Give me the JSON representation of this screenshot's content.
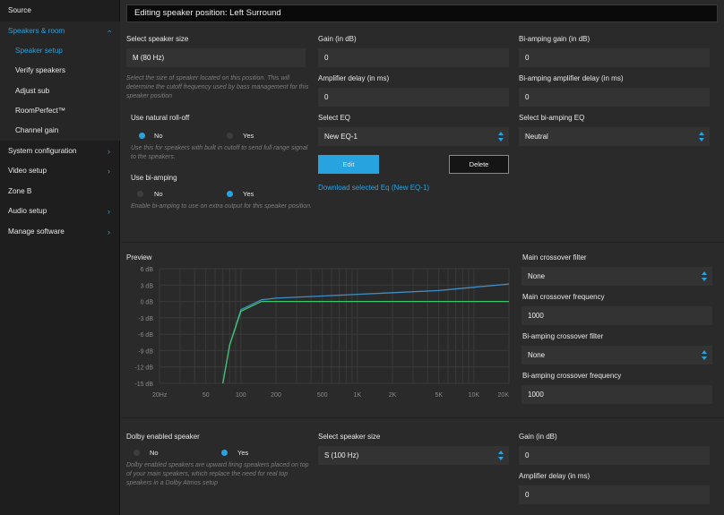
{
  "sidebar": {
    "items": [
      {
        "label": "Source",
        "chevron": ""
      },
      {
        "label": "Speakers & room",
        "chevron": "up"
      },
      {
        "label": "Speaker setup",
        "chevron": ""
      },
      {
        "label": "Verify speakers",
        "chevron": ""
      },
      {
        "label": "Adjust sub",
        "chevron": ""
      },
      {
        "label": "RoomPerfect™",
        "chevron": ""
      },
      {
        "label": "Channel gain",
        "chevron": ""
      },
      {
        "label": "System configuration",
        "chevron": "right"
      },
      {
        "label": "Video setup",
        "chevron": "right"
      },
      {
        "label": "Zone B",
        "chevron": ""
      },
      {
        "label": "Audio setup",
        "chevron": "right"
      },
      {
        "label": "Manage software",
        "chevron": "right"
      }
    ]
  },
  "header": {
    "title": "Editing speaker position: Left Surround"
  },
  "speaker": {
    "size_label": "Select speaker size",
    "size_value": "M (80 Hz)",
    "size_hint": "Select the size of speaker located on this position. This will determine the cutoff frequency used by bass management for this speaker position",
    "rolloff_label": "Use natural roll-off",
    "rolloff_no": "No",
    "rolloff_yes": "Yes",
    "rolloff_hint": "Use this for speakers with built in cutoff to send full range signal to the speakers.",
    "biamp_label": "Use bi-amping",
    "biamp_no": "No",
    "biamp_yes": "Yes",
    "biamp_hint": "Enable bi-amping to use on extra output for this speaker position."
  },
  "gain": {
    "gain_label": "Gain (in dB)",
    "gain_value": "0",
    "delay_label": "Amplifier delay (in ms)",
    "delay_value": "0",
    "eq_label": "Select EQ",
    "eq_value": "New EQ-1",
    "edit_label": "Edit",
    "delete_label": "Delete",
    "download_label": "Download selected Eq (New EQ-1)"
  },
  "biamp": {
    "gain_label": "Bi-amping gain (in dB)",
    "gain_value": "0",
    "delay_label": "Bi-amping amplifier delay (in ms)",
    "delay_value": "0",
    "eq_label": "Select bi-amping EQ",
    "eq_value": "Neutral"
  },
  "preview": {
    "label": "Preview",
    "main_filter_label": "Main crossover filter",
    "main_filter_value": "None",
    "main_freq_label": "Main crossover frequency",
    "main_freq_value": "1000",
    "biamp_filter_label": "Bi-amping crossover filter",
    "biamp_filter_value": "None",
    "biamp_freq_label": "Bi-amping crossover frequency",
    "biamp_freq_value": "1000"
  },
  "chart_data": {
    "type": "line",
    "x_ticks": [
      "20Hz",
      "50",
      "100",
      "200",
      "500",
      "1K",
      "2K",
      "5K",
      "10K",
      "20K"
    ],
    "y_ticks": [
      "6 dB",
      "3 dB",
      "0 dB",
      "-3 dB",
      "-6 dB",
      "-9 dB",
      "-12 dB",
      "-15 dB"
    ],
    "x_scale": "log",
    "xlim": [
      20,
      20000
    ],
    "ylim": [
      -15,
      6
    ],
    "grid": true,
    "series": [
      {
        "color": "#3f8fc7",
        "x": [
          70,
          80,
          100,
          150,
          200,
          500,
          1000,
          2000,
          5000,
          10000,
          20000
        ],
        "y": [
          -15,
          -8,
          -1.5,
          0.3,
          0.6,
          1.0,
          1.3,
          1.6,
          2.0,
          2.6,
          3.2
        ]
      },
      {
        "color": "#3fc46a",
        "x": [
          70,
          80,
          100,
          150,
          200,
          500,
          1000,
          2000,
          5000,
          10000,
          20000
        ],
        "y": [
          -15,
          -8,
          -1.8,
          0,
          0,
          0,
          0,
          0,
          0,
          0,
          0
        ]
      }
    ]
  },
  "dolby": {
    "label": "Dolby enabled speaker",
    "no": "No",
    "yes": "Yes",
    "hint": "Dolby enabled speakers are upward firing speakers placed on top of your main speakers, which replace the need for real top speakers in a Dolby Atmos setup",
    "size_label": "Select speaker size",
    "size_value": "S (100 Hz)",
    "gain_label": "Gain (in dB)",
    "gain_value": "0",
    "delay_label": "Amplifier delay (in ms)",
    "delay_value": "0"
  },
  "colors": {
    "accent": "#27a3e0",
    "background": "#2a2a2a",
    "sidebar": "#1e1e1e",
    "field": "#333333"
  }
}
